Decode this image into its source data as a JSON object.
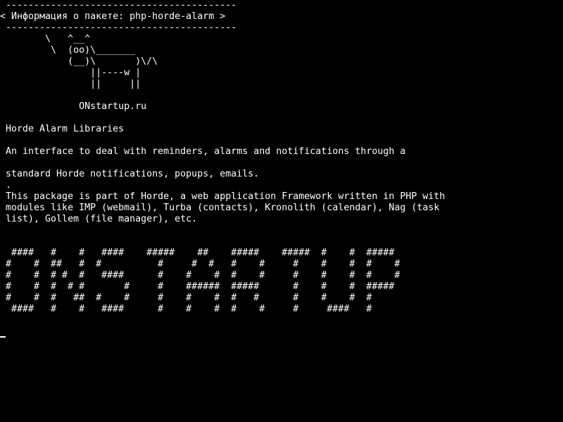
{
  "colors": {
    "background": "#000000",
    "foreground": "#ffffff"
  },
  "cowsay": {
    "bubble_top": " -----------------------------------------",
    "message": "< Информация о пакете: php-horde-alarm >",
    "bubble_bottom": " -----------------------------------------",
    "cow": [
      "        \\   ^__^",
      "         \\  (oo)\\_______",
      "            (__)\\       )\\/\\",
      "                ||----w |",
      "                ||     ||"
    ],
    "site": "              ONstartup.ru"
  },
  "package": {
    "title": " Horde Alarm Libraries",
    "summary_1": " An interface to deal with reminders, alarms and notifications through a",
    "summary_2": " standard Horde notifications, popups, emails.",
    "separator": " .",
    "description": [
      " This package is part of Horde, a web application Framework written in PHP with",
      " modules like IMP (webmail), Turba (contacts), Kronolith (calendar), Nag (task",
      " list), Gollem (file manager), etc."
    ]
  },
  "banner": {
    "lines": [
      "  ####   #    #   ####    #####    ##    #####    #####  #    #  #####",
      " #    #  ##   #  #          #     #  #   #    #     #    #    #  #    #",
      " #    #  # #  #   ####      #    #    #  #    #     #    #    #  #    #",
      " #    #  #  # #       #     #    ######  #####      #    #    #  #####",
      " #    #  #   ##  #    #     #    #    #  #   #      #    #    #  #",
      "  ####   #    #   ####      #    #    #  #    #     #     ####   #"
    ]
  }
}
